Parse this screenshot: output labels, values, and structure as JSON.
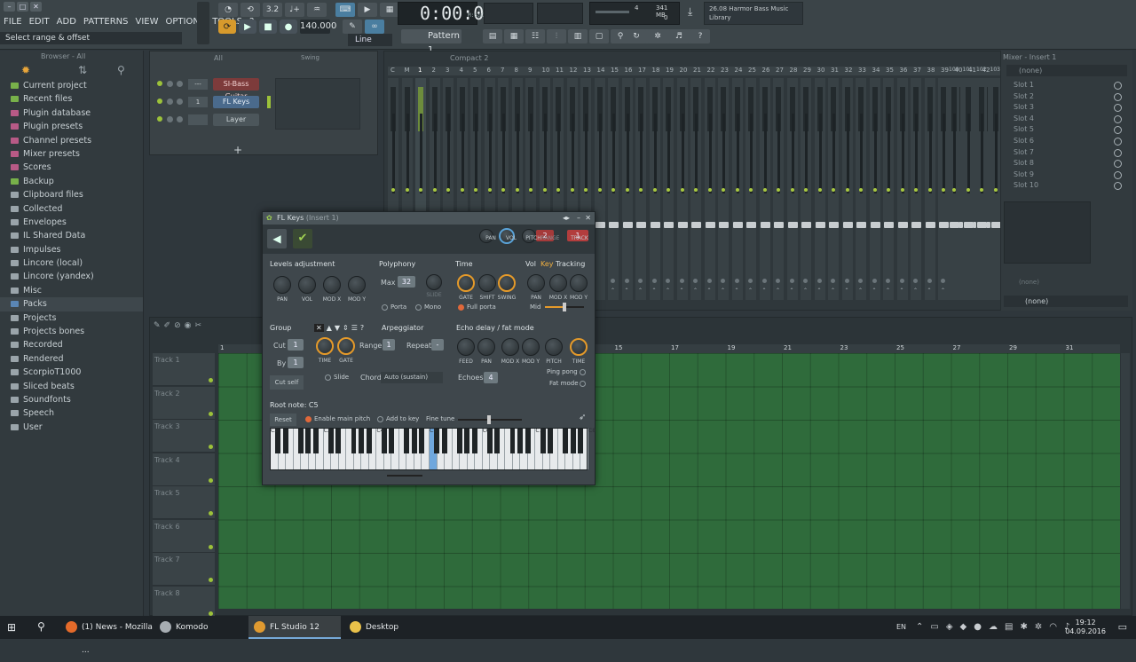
{
  "menu": [
    "FILE",
    "EDIT",
    "ADD",
    "PATTERNS",
    "VIEW",
    "OPTIONS",
    "TOOLS",
    "?"
  ],
  "hint": "Select range & offset",
  "tempo": "140.000",
  "time": "0:00:00",
  "time_unit": "M:S:CS",
  "cpu": {
    "value": "4",
    "mem": "341 MB",
    "poly": "0"
  },
  "news": {
    "line1": "26.08  Harmor Bass Music",
    "line2": "Library"
  },
  "pattern": "Pattern 1",
  "snap": "Line",
  "browser": {
    "header": "Browser - All",
    "items": [
      {
        "label": "Current project",
        "icon": "green"
      },
      {
        "label": "Recent files",
        "icon": "green"
      },
      {
        "label": "Plugin database",
        "icon": "pink"
      },
      {
        "label": "Plugin presets",
        "icon": "pink"
      },
      {
        "label": "Channel presets",
        "icon": "pink"
      },
      {
        "label": "Mixer presets",
        "icon": "pink"
      },
      {
        "label": "Scores",
        "icon": "pink"
      },
      {
        "label": "Backup",
        "icon": "green"
      },
      {
        "label": "Clipboard files",
        "icon": "grey"
      },
      {
        "label": "Collected",
        "icon": "grey"
      },
      {
        "label": "Envelopes",
        "icon": "grey"
      },
      {
        "label": "IL Shared Data",
        "icon": "grey"
      },
      {
        "label": "Impulses",
        "icon": "grey"
      },
      {
        "label": "Lincore (local)",
        "icon": "grey"
      },
      {
        "label": "Lincore (yandex)",
        "icon": "grey"
      },
      {
        "label": "Misc",
        "icon": "grey"
      },
      {
        "label": "Packs",
        "icon": "blue"
      },
      {
        "label": "Projects",
        "icon": "grey"
      },
      {
        "label": "Projects bones",
        "icon": "grey"
      },
      {
        "label": "Recorded",
        "icon": "grey"
      },
      {
        "label": "Rendered",
        "icon": "grey"
      },
      {
        "label": "ScorpioT1000",
        "icon": "grey"
      },
      {
        "label": "Sliced beats",
        "icon": "grey"
      },
      {
        "label": "Soundfonts",
        "icon": "grey"
      },
      {
        "label": "Speech",
        "icon": "grey"
      },
      {
        "label": "User",
        "icon": "grey"
      }
    ]
  },
  "rack": {
    "filter": "All",
    "swing": "Swing",
    "channels": [
      {
        "label": "SI-Bass Guitar",
        "num": "---"
      },
      {
        "label": "FL Keys",
        "num": "1"
      },
      {
        "label": "Layer",
        "num": ""
      }
    ],
    "add": "+"
  },
  "mixer": {
    "layout": "Compact 2",
    "title": "Mixer - Insert 1",
    "top_slot": "(none)",
    "slots": [
      "Slot 1",
      "Slot 2",
      "Slot 3",
      "Slot 4",
      "Slot 5",
      "Slot 6",
      "Slot 7",
      "Slot 8",
      "Slot 9",
      "Slot 10"
    ],
    "eq_none": "(none)",
    "out_none": "(none)",
    "strip_nums_left": [
      "C",
      "M",
      "1",
      "2",
      "3",
      "4",
      "5",
      "6",
      "7",
      "8",
      "9",
      "10",
      "11",
      "12",
      "13",
      "14",
      "15",
      "16",
      "17",
      "18",
      "19",
      "20",
      "21",
      "22",
      "23",
      "24",
      "25",
      "26",
      "27",
      "28",
      "29",
      "30",
      "31",
      "32",
      "33",
      "34",
      "35",
      "36",
      "37",
      "38",
      "39",
      "40",
      "41",
      "42"
    ],
    "strip_nums_right": [
      "100",
      "101",
      "102",
      "103"
    ]
  },
  "playlist": {
    "tracks": [
      "Track 1",
      "Track 2",
      "Track 3",
      "Track 4",
      "Track 5",
      "Track 6",
      "Track 7",
      "Track 8"
    ],
    "ruler": [
      "1",
      "2",
      "3",
      "4",
      "5",
      "6",
      "7",
      "8",
      "9",
      "10",
      "11",
      "12",
      "13",
      "14",
      "15",
      "16",
      "17",
      "18",
      "19",
      "20",
      "21",
      "22",
      "23",
      "24",
      "25",
      "26",
      "27",
      "28",
      "29",
      "30",
      "31",
      "32"
    ]
  },
  "plugin": {
    "title": "FL Keys",
    "subtitle": "(Insert 1)",
    "pitch_value": "2",
    "track_value": "1",
    "top_knobs": [
      "PAN",
      "VOL",
      "PITCH",
      "RANGE",
      "TRACK"
    ],
    "levels": {
      "title": "Levels adjustment",
      "knobs": [
        "PAN",
        "VOL",
        "MOD X",
        "MOD Y"
      ]
    },
    "poly": {
      "title": "Polyphony",
      "max_label": "Max",
      "max_value": "32",
      "slide": "SLIDE",
      "porta": "Porta",
      "mono": "Mono"
    },
    "time": {
      "title": "Time",
      "knobs": [
        "GATE",
        "SHIFT",
        "SWING"
      ],
      "full_porta": "Full porta"
    },
    "tracking": {
      "vol": "Vol",
      "key": "Key",
      "title": "Tracking",
      "knobs": [
        "PAN",
        "MOD X",
        "MOD Y"
      ],
      "mid": "Mid"
    },
    "group": {
      "title": "Group",
      "cut": "Cut",
      "by": "By",
      "cut_val": "1",
      "by_val": "1",
      "cut_self": "Cut self"
    },
    "arp": {
      "title": "Arpeggiator",
      "range": "Range",
      "range_val": "1",
      "repeat": "Repeat",
      "repeat_val": "-",
      "knobs": [
        "TIME",
        "GATE"
      ],
      "slide": "Slide",
      "chord": "Chord",
      "chord_val": "Auto (sustain)"
    },
    "echo": {
      "title": "Echo delay / fat mode",
      "knobs": [
        "FEED",
        "PAN",
        "MOD X",
        "MOD Y",
        "PITCH",
        "TIME"
      ],
      "echoes": "Echoes",
      "echoes_val": "4",
      "ping": "Ping pong",
      "fat": "Fat mode"
    },
    "root": {
      "label": "Root note: C5",
      "reset": "Reset",
      "enable_pitch": "Enable main pitch",
      "add_key": "Add to key",
      "fine": "Fine tune"
    },
    "octaves": [
      "C2",
      "C3",
      "C4",
      "C5",
      "C6",
      "C7",
      "C8"
    ]
  },
  "taskbar": {
    "items": [
      {
        "label": "(1) News - Mozilla ...",
        "color": "#e46a2a"
      },
      {
        "label": "Komodo",
        "color": "#a7adb2"
      },
      {
        "label": "FL Studio 12",
        "color": "#e09a30"
      },
      {
        "label": "Desktop",
        "color": "#e9c14a"
      }
    ],
    "lang": "EN",
    "time": "19:12",
    "date": "04.09.2016"
  }
}
